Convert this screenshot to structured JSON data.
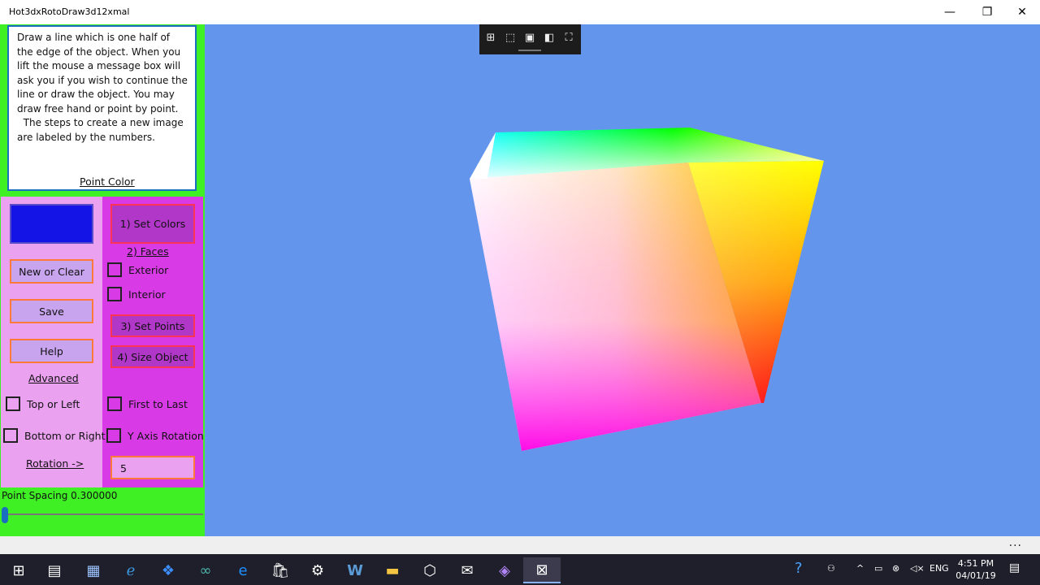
{
  "window": {
    "title": "Hot3dxRotoDraw3d12xmal",
    "minimize_glyph": "—",
    "maximize_glyph": "❐",
    "close_glyph": "✕"
  },
  "left_panel": {
    "instructions": "Draw a line which is one half of the edge of the object. When you lift the mouse a message box will ask you if you wish to continue the line or draw the object. You may draw free hand or point by point.\n  The steps to create a new image are labeled by the numbers.",
    "point_color_label": "Point Color",
    "swatch_color": "#1414e6",
    "buttons": {
      "new_or_clear": "New or Clear",
      "save": "Save",
      "help": "Help",
      "set_colors": "1) Set Colors",
      "set_points": "3) Set Points",
      "size_object": "4) Size Object"
    },
    "faces_label": "2) Faces",
    "advanced_label": "Advanced",
    "rotation_label": "Rotation ->",
    "checkboxes": {
      "exterior": "Exterior",
      "interior": "Interior",
      "top_or_left": "Top or Left",
      "first_to_last": "First to Last",
      "bottom_or_right": "Bottom or Right",
      "y_axis_rotation": "Y Axis Rotation"
    },
    "rotation_value": "5",
    "point_spacing_label": "Point Spacing 0.300000"
  },
  "viewport": {
    "background": "#6495ed"
  },
  "graphics_toolbar": {
    "icons": [
      "live-visual-tree-icon",
      "select-element-icon",
      "display-layout-adorners-icon",
      "track-focus-icon",
      "preview-selection-icon"
    ]
  },
  "bottom_bar": {
    "more": "..."
  },
  "taskbar": {
    "clock_time": "4:51 PM",
    "clock_date": "04/01/19",
    "language": "ENG"
  }
}
